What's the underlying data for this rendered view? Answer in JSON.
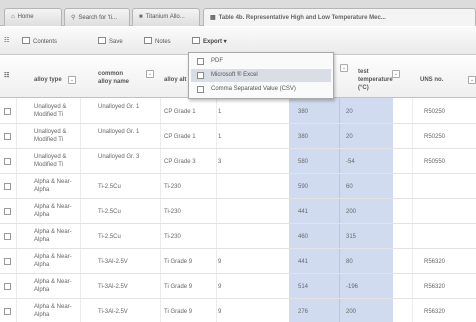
{
  "tabs": [
    {
      "icon": "home-icon",
      "glyph": "⌂",
      "label": "Home"
    },
    {
      "icon": "search-icon",
      "glyph": "⚲",
      "label": "Search for 'ti..."
    },
    {
      "icon": "book-icon",
      "glyph": "■",
      "label": "Titanium Allo..."
    },
    {
      "icon": "table-icon",
      "glyph": "▦",
      "label": "Table 4b. Representative High and Low Temperature Mec..."
    }
  ],
  "toolbar": {
    "contents": "Contents",
    "save": "Save",
    "notes": "Notes",
    "export": "Export ▾"
  },
  "export_menu": {
    "items": [
      "PDF",
      "Microsoft ® Excel",
      "Comma Separated Value (CSV)"
    ],
    "highlighted_index": 1
  },
  "columns": {
    "alloy_type": "alloy type",
    "common_alloy_name": "common alloy name",
    "alloy_alt": "alloy alt",
    "test_temperature": "test temperature (°C)",
    "uns_no": "UNS no."
  },
  "rows": [
    {
      "alloy_type": "Unalloyed & Modified Ti",
      "common_name": "Unalloyed Gr. 1",
      "alt_name": "CP Grade 1",
      "alt_num": "1",
      "v1": "380",
      "v2": "20",
      "uns": "R50250"
    },
    {
      "alloy_type": "Unalloyed & Modified Ti",
      "common_name": "Unalloyed Gr. 1",
      "alt_name": "CP Grade 1",
      "alt_num": "1",
      "v1": "380",
      "v2": "20",
      "uns": "R50250"
    },
    {
      "alloy_type": "Unalloyed & Modified Ti",
      "common_name": "Unalloyed Gr. 3",
      "alt_name": "CP Grade 3",
      "alt_num": "3",
      "v1": "580",
      "v2": "-54",
      "uns": "R50550"
    },
    {
      "alloy_type": "Alpha & Near-Alpha",
      "common_name": "Ti-2.5Cu",
      "alt_name": "Ti-230",
      "alt_num": "",
      "v1": "590",
      "v2": "60",
      "uns": ""
    },
    {
      "alloy_type": "Alpha & Near-Alpha",
      "common_name": "Ti-2.5Cu",
      "alt_name": "Ti-230",
      "alt_num": "",
      "v1": "441",
      "v2": "200",
      "uns": ""
    },
    {
      "alloy_type": "Alpha & Near-Alpha",
      "common_name": "Ti-2.5Cu",
      "alt_name": "Ti-230",
      "alt_num": "",
      "v1": "460",
      "v2": "315",
      "uns": ""
    },
    {
      "alloy_type": "Alpha & Near-Alpha",
      "common_name": "Ti-3Al-2.5V",
      "alt_name": "Ti Grade 9",
      "alt_num": "9",
      "v1": "441",
      "v2": "80",
      "uns": "R56320"
    },
    {
      "alloy_type": "Alpha & Near-Alpha",
      "common_name": "Ti-3Al-2.5V",
      "alt_name": "Ti Grade 9",
      "alt_num": "9",
      "v1": "514",
      "v2": "-196",
      "uns": "R56320"
    },
    {
      "alloy_type": "Alpha & Near-Alpha",
      "common_name": "Ti-3Al-2.5V",
      "alt_name": "Ti Grade 9",
      "alt_num": "9",
      "v1": "276",
      "v2": "200",
      "uns": "R56320"
    }
  ],
  "colors": {
    "highlight_column": "#d1dbef",
    "menu_highlight": "#d9dde6"
  }
}
